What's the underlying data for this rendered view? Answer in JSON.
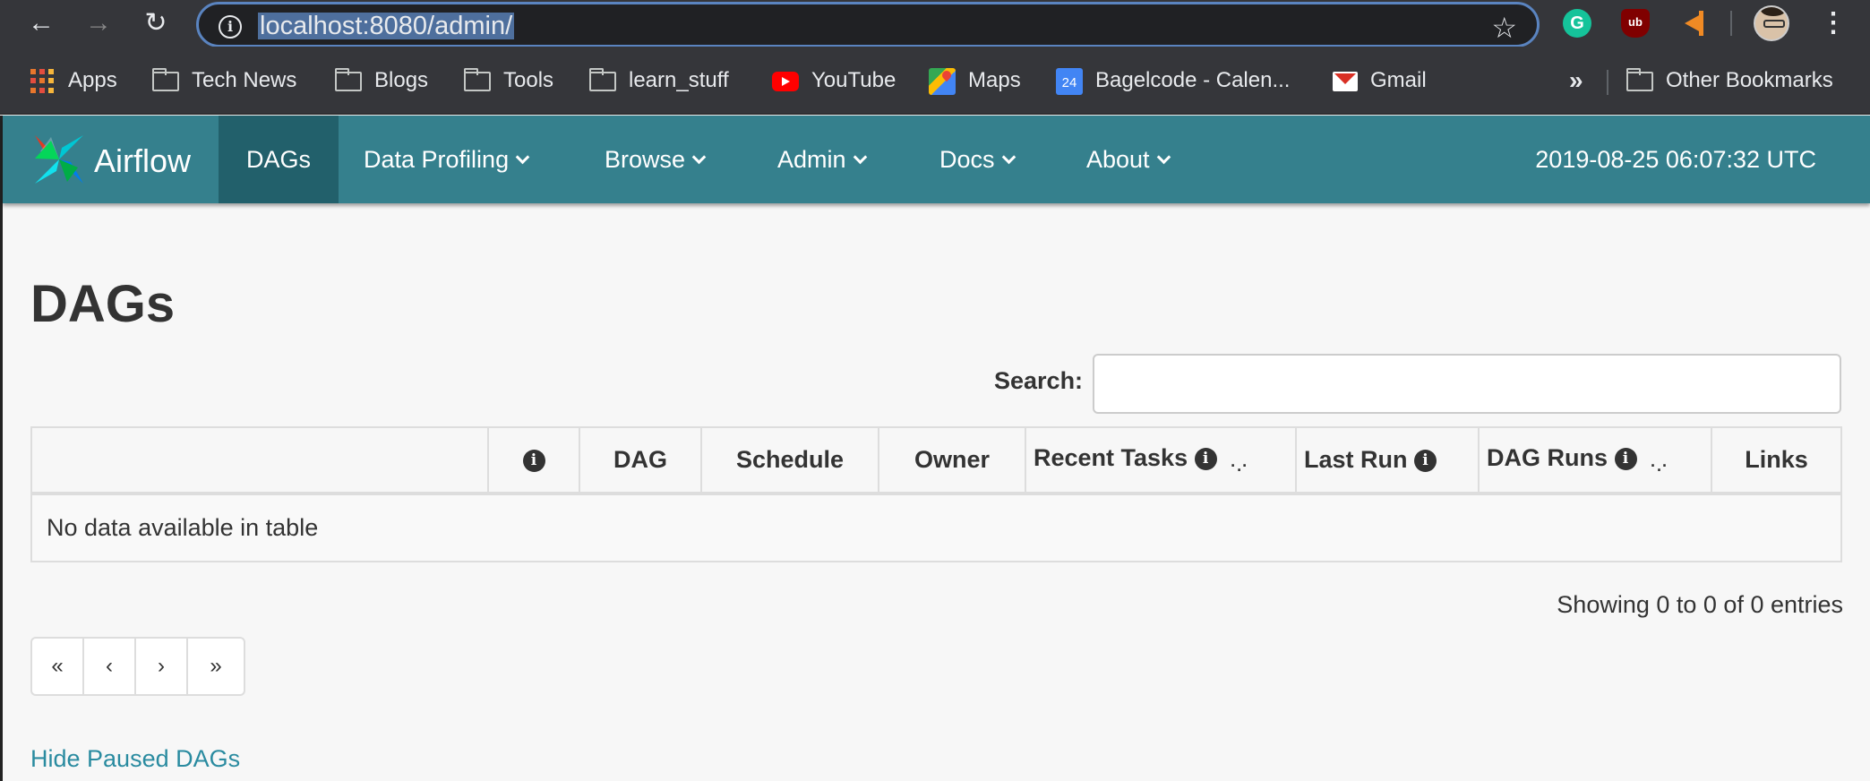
{
  "browser": {
    "url": "localhost:8080/admin/",
    "bookmarks": [
      {
        "label": "Apps",
        "icon": "apps-grid-icon"
      },
      {
        "label": "Tech News",
        "icon": "folder-icon"
      },
      {
        "label": "Blogs",
        "icon": "folder-icon"
      },
      {
        "label": "Tools",
        "icon": "folder-icon"
      },
      {
        "label": "learn_stuff",
        "icon": "folder-icon"
      },
      {
        "label": "YouTube",
        "icon": "youtube-icon"
      },
      {
        "label": "Maps",
        "icon": "maps-icon"
      },
      {
        "label": "Bagelcode - Calen...",
        "icon": "calendar-icon",
        "icon_text": "24"
      },
      {
        "label": "Gmail",
        "icon": "gmail-icon"
      }
    ],
    "bookmarks_more": "»",
    "other_bookmarks": "Other Bookmarks",
    "extensions": {
      "grammarly": "G",
      "ublock": "ub"
    }
  },
  "navbar": {
    "brand": "Airflow",
    "items": [
      {
        "label": "DAGs",
        "active": true
      },
      {
        "label": "Data Profiling",
        "dropdown": true
      },
      {
        "label": "Browse",
        "dropdown": true
      },
      {
        "label": "Admin",
        "dropdown": true
      },
      {
        "label": "Docs",
        "dropdown": true
      },
      {
        "label": "About",
        "dropdown": true
      }
    ],
    "clock": "2019-08-25 06:07:32 UTC",
    "colors": {
      "bar": "#35808d",
      "active": "#22606b"
    }
  },
  "main": {
    "title": "DAGs",
    "search_label": "Search:",
    "search_value": "",
    "table": {
      "columns": [
        {
          "label": ""
        },
        {
          "label": "",
          "info": true
        },
        {
          "label": "DAG"
        },
        {
          "label": "Schedule"
        },
        {
          "label": "Owner"
        },
        {
          "label": "Recent Tasks",
          "info": true,
          "loading": true
        },
        {
          "label": "Last Run",
          "info": true
        },
        {
          "label": "DAG Runs",
          "info": true,
          "loading": true
        },
        {
          "label": "Links"
        }
      ],
      "empty_message": "No data available in table"
    },
    "showing": "Showing 0 to 0 of 0 entries",
    "pager": [
      "«",
      "‹",
      "›",
      "»"
    ],
    "hide_paused_link": "Hide Paused DAGs"
  }
}
